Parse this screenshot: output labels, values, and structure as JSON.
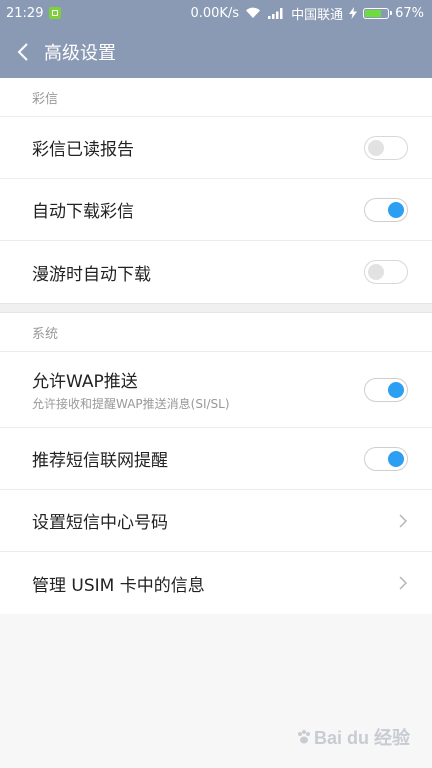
{
  "status_bar": {
    "time": "21:29",
    "speed": "0.00K/s",
    "carrier": "中国联通",
    "battery_level": 0.67,
    "battery_pct": "67%"
  },
  "header": {
    "title": "高级设置"
  },
  "sections": [
    {
      "title": "彩信",
      "items": [
        {
          "label": "彩信已读报告",
          "toggle": false
        },
        {
          "label": "自动下载彩信",
          "toggle": true
        },
        {
          "label": "漫游时自动下载",
          "toggle": false
        }
      ]
    },
    {
      "title": "系统",
      "items": [
        {
          "label": "允许WAP推送",
          "sublabel": "允许接收和提醒WAP推送消息(SI/SL)",
          "toggle": true
        },
        {
          "label": "推荐短信联网提醒",
          "toggle": true
        },
        {
          "label": "设置短信中心号码"
        },
        {
          "label": "管理 USIM 卡中的信息"
        }
      ]
    }
  ],
  "watermark": "Bai du 经验",
  "colors": {
    "header_bg": "#8a9ab4",
    "toggle_on": "#2d9ff2",
    "battery_fill": "#6ddc3e"
  }
}
